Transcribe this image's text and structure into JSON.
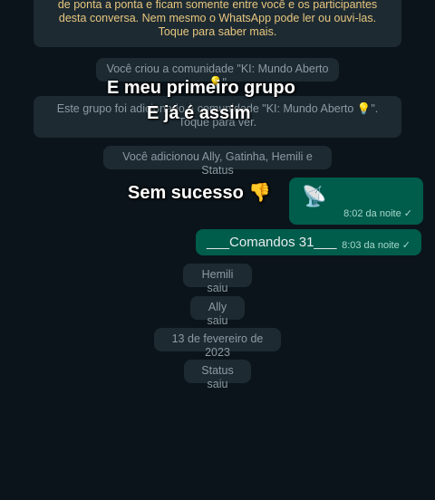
{
  "encryption_notice": "de ponta a ponta e ficam somente entre você e os participantes desta conversa. Nem mesmo o WhatsApp pode ler ou ouvi-las. Toque para saber mais.",
  "system_messages": {
    "created": "Você criou a comunidade \"KI: Mundo Aberto 💡\"",
    "group_added": "Este grupo foi adicionado à comunidade \"KI: Mundo Aberto 💡\". Toque para ver.",
    "added_members": "Você adicionou Ally, Gatinha, Hemili e Status",
    "hemili_left": "Hemili saiu",
    "ally_left": "Ally saiu",
    "date_chip": "13 de fevereiro de 2023",
    "status_left": "Status saiu"
  },
  "messages": [
    {
      "text": "📡",
      "time": "8:02 da noite",
      "ticks": "✓"
    },
    {
      "text": "___Comandos 31___",
      "time": "8:03 da noite",
      "ticks": "✓"
    }
  ],
  "overlay": {
    "line1": "E meu primeiro grupo",
    "line2": "E já é assim",
    "line3": "Sem sucesso 👎"
  }
}
